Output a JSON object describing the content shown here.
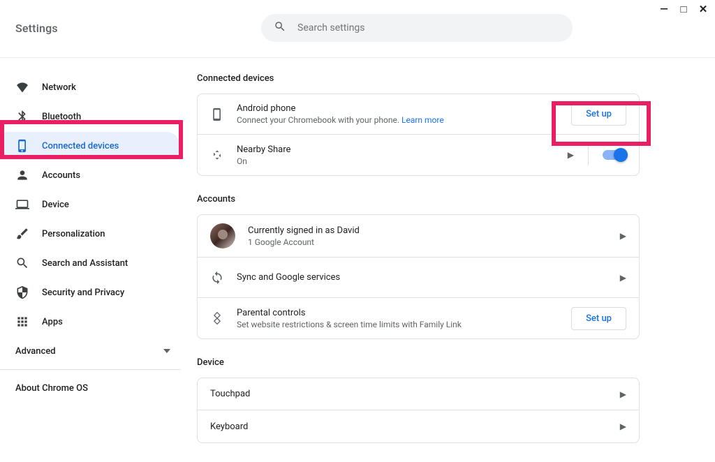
{
  "window": {
    "minimize": "—",
    "maximize": "□",
    "close": "✕"
  },
  "header": {
    "title": "Settings",
    "search_placeholder": "Search settings"
  },
  "sidebar": {
    "items": [
      {
        "label": "Network",
        "icon": "wifi-icon",
        "active": false
      },
      {
        "label": "Bluetooth",
        "icon": "bluetooth-icon",
        "active": false
      },
      {
        "label": "Connected devices",
        "icon": "phone-icon",
        "active": true
      },
      {
        "label": "Accounts",
        "icon": "person-icon",
        "active": false
      },
      {
        "label": "Device",
        "icon": "laptop-icon",
        "active": false
      },
      {
        "label": "Personalization",
        "icon": "paint-icon",
        "active": false
      },
      {
        "label": "Search and Assistant",
        "icon": "search-icon",
        "active": false
      },
      {
        "label": "Security and Privacy",
        "icon": "shield-icon",
        "active": false
      },
      {
        "label": "Apps",
        "icon": "apps-icon",
        "active": false
      }
    ],
    "advanced": "Advanced",
    "about": "About Chrome OS"
  },
  "main": {
    "connected": {
      "title": "Connected devices",
      "android": {
        "title": "Android phone",
        "sub": "Connect your Chromebook with your phone. ",
        "link": "Learn more",
        "button": "Set up"
      },
      "nearby": {
        "title": "Nearby Share",
        "sub": "On"
      }
    },
    "accounts": {
      "title": "Accounts",
      "signedin": {
        "title": "Currently signed in as David",
        "sub": "1 Google Account"
      },
      "sync": {
        "title": "Sync and Google services"
      },
      "parental": {
        "title": "Parental controls",
        "sub": "Set website restrictions & screen time limits with Family Link",
        "button": "Set up"
      }
    },
    "device": {
      "title": "Device",
      "touchpad": {
        "title": "Touchpad"
      },
      "keyboard": {
        "title": "Keyboard"
      }
    }
  }
}
